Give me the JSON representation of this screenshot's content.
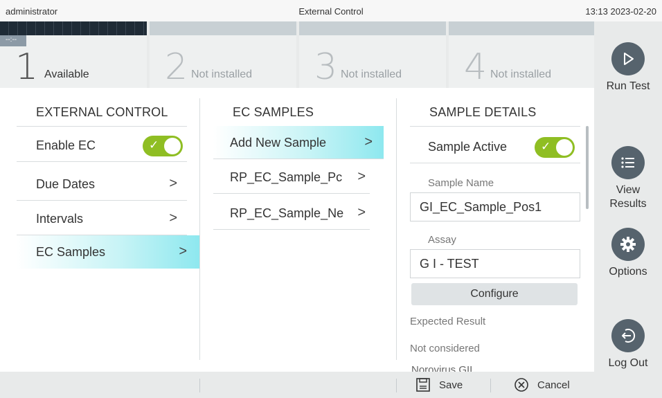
{
  "topbar": {
    "user": "administrator",
    "title": "External Control",
    "datetime": "13:13 2023-02-20"
  },
  "modules": [
    {
      "number": "1",
      "status": "Available",
      "tag": "--:--"
    },
    {
      "number": "2",
      "status": "Not installed"
    },
    {
      "number": "3",
      "status": "Not installed"
    },
    {
      "number": "4",
      "status": "Not installed"
    }
  ],
  "sidebar": {
    "run_test": "Run Test",
    "view_results": "View Results",
    "options": "Options",
    "log_out": "Log Out"
  },
  "external_control": {
    "title": "EXTERNAL CONTROL",
    "items": [
      {
        "label": "Enable EC",
        "toggle": true
      },
      {
        "label": "Due Dates"
      },
      {
        "label": "Intervals"
      },
      {
        "label": "EC Samples"
      }
    ]
  },
  "ec_samples": {
    "title": "EC SAMPLES",
    "items": [
      {
        "label": "Add New Sample"
      },
      {
        "label": "RP_EC_Sample_Pc"
      },
      {
        "label": "RP_EC_Sample_Ne"
      }
    ]
  },
  "sample_details": {
    "title": "SAMPLE DETAILS",
    "sample_active_label": "Sample Active",
    "sample_active": true,
    "sample_name_label": "Sample Name",
    "sample_name_value": "GI_EC_Sample_Pos1",
    "assay_label": "Assay",
    "assay_value": "G I - TEST",
    "configure_label": "Configure",
    "expected_result_label": "Expected Result",
    "expected_result_value": "Not considered",
    "cutoff_text": "Norovirus GII"
  },
  "bottombar": {
    "save": "Save",
    "cancel": "Cancel"
  },
  "colors": {
    "accent_green": "#8fbe23",
    "active_cyan": "#8ee8ef",
    "icon_gray": "#56636d"
  }
}
